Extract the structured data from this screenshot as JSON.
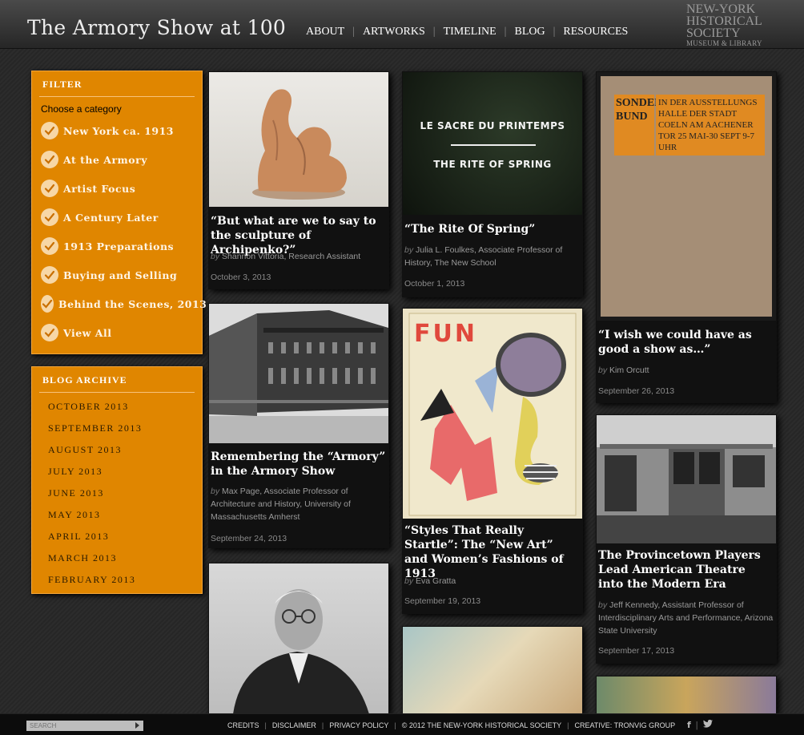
{
  "header": {
    "site_title": "The Armory Show at 100",
    "nav": [
      "ABOUT",
      "ARTWORKS",
      "TIMELINE",
      "BLOG",
      "RESOURCES"
    ],
    "logo": {
      "line1": "NEW-YORK",
      "line2": "HISTORICAL",
      "line3": "SOCIETY",
      "line4": "MUSEUM & LIBRARY"
    }
  },
  "filter": {
    "heading": "FILTER",
    "choose": "Choose a category",
    "items": [
      "New York ca. 1913",
      "At the Armory",
      "Artist Focus",
      "A Century Later",
      "1913 Preparations",
      "Buying and Selling",
      "Behind the Scenes, 2013",
      "View All"
    ]
  },
  "archive": {
    "heading": "BLOG ARCHIVE",
    "items": [
      "OCTOBER 2013",
      "SEPTEMBER 2013",
      "AUGUST 2013",
      "JULY 2013",
      "JUNE 2013",
      "MAY 2013",
      "APRIL 2013",
      "MARCH 2013",
      "FEBRUARY 2013"
    ]
  },
  "posts": [
    {
      "title": "“But what are we to say to the sculpture of Archipenko?”",
      "by": "by",
      "author": "Shannon Vittoria, Research Assistant",
      "date": "October 3, 2013"
    },
    {
      "title": "“The Rite Of Spring”",
      "by": "by",
      "author": "Julia L. Foulkes, Associate Professor of History, The New School",
      "date": "October 1, 2013",
      "image_text1": "LE SACRE DU PRINTEMPS",
      "image_text2": "THE RITE OF SPRING"
    },
    {
      "title": "“I wish we could have as good a show as…”",
      "by": "by",
      "author": "Kim Orcutt",
      "date": "September 26, 2013",
      "image_text1": "SONDER BUND",
      "image_text2": "IN DER AUSSTELLUNGS HALLE DER STADT COELN AM AACHENER TOR 25 MAI-30 SEPT 9-7 UHR"
    },
    {
      "title": "Remembering the “Armory” in the Armory Show",
      "by": "by",
      "author": "Max Page, Associate Professor of Architecture and History, University of Massachusetts Amherst",
      "date": "September 24, 2013"
    },
    {
      "title": "“Styles That Really Startle”: The “New Art” and Women’s Fashions of 1913",
      "by": "by",
      "author": "Eva Gratta",
      "date": "September 19, 2013",
      "image_text1": "FUN"
    },
    {
      "title": "The Provincetown Players Lead American Theatre into the Modern Era",
      "by": "by",
      "author": "Jeff Kennedy, Assistant Professor of Interdisciplinary Arts and Performance, Arizona State University",
      "date": "September 17, 2013"
    }
  ],
  "footer": {
    "search_placeholder": "SEARCH",
    "links": [
      "CREDITS",
      "DISCLAIMER",
      "PRIVACY POLICY",
      "© 2012 THE NEW-YORK HISTORICAL SOCIETY",
      "CREATIVE: TRONVIG GROUP"
    ]
  },
  "colors": {
    "accent": "#e08600",
    "background": "#2a2a2a",
    "card": "#111111"
  }
}
